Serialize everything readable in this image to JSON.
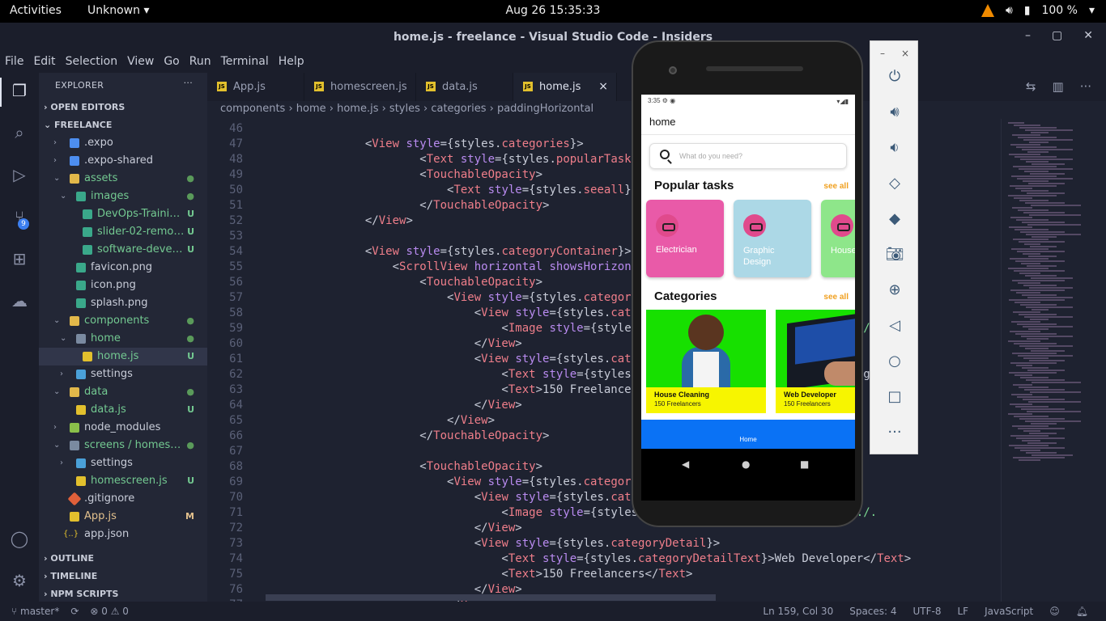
{
  "topbar": {
    "activities": "Activities",
    "app_menu": "Unknown ▾",
    "clock": "Aug 26  15:35:33",
    "battery": "100 %"
  },
  "window": {
    "title": "home.js - freelance - Visual Studio Code - Insiders"
  },
  "menu": [
    "File",
    "Edit",
    "Selection",
    "View",
    "Go",
    "Run",
    "Terminal",
    "Help"
  ],
  "activity_bar": {
    "remote_badge": "9"
  },
  "sidebar": {
    "header": "EXPLORER",
    "more": "···",
    "open_editors": "OPEN EDITORS",
    "project": "FREELANCE",
    "tree": [
      {
        "name": ".expo",
        "status": ""
      },
      {
        "name": ".expo-shared",
        "status": ""
      },
      {
        "name": "assets",
        "status": "●"
      },
      {
        "name": "images",
        "status": "●"
      },
      {
        "name": "DevOps-Trainin...",
        "status": "U"
      },
      {
        "name": "slider-02-remov...",
        "status": "U"
      },
      {
        "name": "software-devel...",
        "status": "U"
      },
      {
        "name": "favicon.png",
        "status": ""
      },
      {
        "name": "icon.png",
        "status": ""
      },
      {
        "name": "splash.png",
        "status": ""
      },
      {
        "name": "components",
        "status": "●"
      },
      {
        "name": "home",
        "status": "●"
      },
      {
        "name": "home.js",
        "status": "U"
      },
      {
        "name": "settings",
        "status": ""
      },
      {
        "name": "data",
        "status": "●"
      },
      {
        "name": "data.js",
        "status": "U"
      },
      {
        "name": "node_modules",
        "status": ""
      },
      {
        "name": "screens / homesc...",
        "status": "●"
      },
      {
        "name": "settings",
        "status": ""
      },
      {
        "name": "homescreen.js",
        "status": "U"
      },
      {
        "name": ".gitignore",
        "status": ""
      },
      {
        "name": "App.js",
        "status": "M"
      },
      {
        "name": "app.json",
        "status": ""
      }
    ],
    "outline": "OUTLINE",
    "timeline": "TIMELINE",
    "npm_scripts": "NPM SCRIPTS"
  },
  "tabs": [
    {
      "label": "App.js"
    },
    {
      "label": "homescreen.js"
    },
    {
      "label": "data.js"
    },
    {
      "label": "home.js",
      "close": "×"
    }
  ],
  "breadcrumb": "components  ›  home  ›  home.js  ›  styles  ›  categories  ›  paddingHorizontal",
  "editor": {
    "lines": [
      {
        "n": "46",
        "code": ""
      },
      {
        "n": "47",
        "code": "                <View style={styles.categories}>"
      },
      {
        "n": "48",
        "code": "                        <Text style={styles.popularTasks}>Popular tasks</Text>"
      },
      {
        "n": "49",
        "code": "                        <TouchableOpacity>"
      },
      {
        "n": "50",
        "code": "                            <Text style={styles.seeall}>see all</Text>"
      },
      {
        "n": "51",
        "code": "                        </TouchableOpacity>"
      },
      {
        "n": "52",
        "code": "                </View>"
      },
      {
        "n": "53",
        "code": ""
      },
      {
        "n": "54",
        "code": "                <View style={styles.categoryContainer}>"
      },
      {
        "n": "55",
        "code": "                    <ScrollView horizontal showsHorizontalScrollIndicator={false}>"
      },
      {
        "n": "56",
        "code": "                        <TouchableOpacity>"
      },
      {
        "n": "57",
        "code": "                            <View style={styles.categoryCard}>"
      },
      {
        "n": "58",
        "code": "                                <View style={styles.categoryImage}>"
      },
      {
        "n": "59",
        "code": "                                    <Image style={styles.categoryImg} source={require('../."
      },
      {
        "n": "60",
        "code": "                                </View>"
      },
      {
        "n": "61",
        "code": "                                <View style={styles.categoryDetail}>"
      },
      {
        "n": "62",
        "code": "                                    <Text style={styles.categoryDetailText}>House Cleaning</Text>"
      },
      {
        "n": "63",
        "code": "                                    <Text>150 Freelancers</Text>"
      },
      {
        "n": "64",
        "code": "                                </View>"
      },
      {
        "n": "65",
        "code": "                            </View>"
      },
      {
        "n": "66",
        "code": "                        </TouchableOpacity>"
      },
      {
        "n": "67",
        "code": ""
      },
      {
        "n": "68",
        "code": "                        <TouchableOpacity>"
      },
      {
        "n": "69",
        "code": "                            <View style={styles.categoryCard}>"
      },
      {
        "n": "70",
        "code": "                                <View style={styles.categoryImage}>"
      },
      {
        "n": "71",
        "code": "                                    <Image style={styles.categoryImg} source={require('../."
      },
      {
        "n": "72",
        "code": "                                </View>"
      },
      {
        "n": "73",
        "code": "                                <View style={styles.categoryDetail}>"
      },
      {
        "n": "74",
        "code": "                                    <Text style={styles.categoryDetailText}>Web Developer</Text>"
      },
      {
        "n": "75",
        "code": "                                    <Text>150 Freelancers</Text>"
      },
      {
        "n": "76",
        "code": "                                </View>"
      },
      {
        "n": "77",
        "code": "                            </View>"
      }
    ]
  },
  "statusbar": {
    "branch": "master*",
    "problems": "⊗ 0 ⚠ 0",
    "position": "Ln 159, Col 30",
    "spaces": "Spaces: 4",
    "encoding": "UTF-8",
    "eol": "LF",
    "language": "JavaScript"
  },
  "phone": {
    "time": "3:35",
    "app_title": "home",
    "search_placeholder": "What do you need?",
    "popular_title": "Popular tasks",
    "popular_seeall": "see all",
    "popular_cards": [
      {
        "label": "Electrician",
        "color": "#e95aa8"
      },
      {
        "label": "Graphic Design",
        "color": "#acd8e6"
      },
      {
        "label": "House Keep",
        "color": "#8ee68a"
      }
    ],
    "categories_title": "Categories",
    "categories_seeall": "see all",
    "category_cards": [
      {
        "title": "House Cleaning",
        "subtitle": "150 Freelancers"
      },
      {
        "title": "Web Developer",
        "subtitle": "150 Freelancers"
      }
    ],
    "tab_label": "Home"
  },
  "emulator_tools": {
    "minimize": "–",
    "close": "×",
    "more": "···"
  }
}
